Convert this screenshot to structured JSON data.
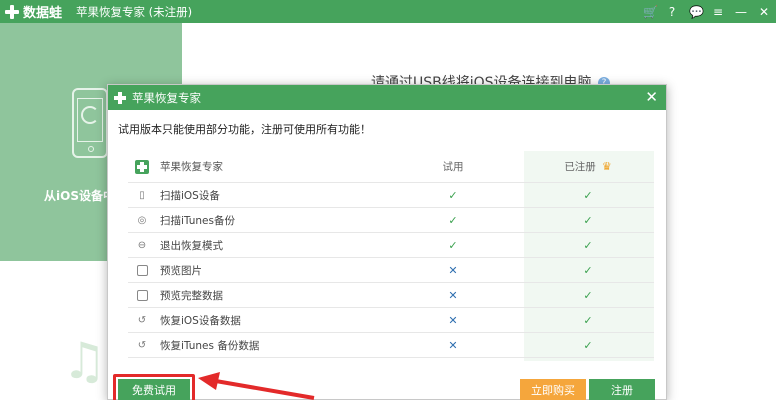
{
  "titlebar": {
    "brand": "数据蛙",
    "title": "苹果恢复专家 (未注册)",
    "icons": [
      "cart-icon",
      "settings-icon",
      "message-icon",
      "menu-icon",
      "minimize-icon",
      "close-icon"
    ]
  },
  "background": {
    "left_label": "从iOS设备中",
    "instruction": "请通过USB线将iOS设备连接到电脑"
  },
  "dialog": {
    "title": "苹果恢复专家",
    "notice": "试用版本只能使用部分功能，注册可使用所有功能！",
    "header": {
      "product": "苹果恢复专家",
      "trial": "试用",
      "registered": "已注册"
    },
    "rows": [
      {
        "icon": "phone-icon",
        "label": "扫描iOS设备",
        "trial": "✓",
        "registered": "✓"
      },
      {
        "icon": "itunes-icon",
        "label": "扫描iTunes备份",
        "trial": "✓",
        "registered": "✓"
      },
      {
        "icon": "exit-icon",
        "label": "退出恢复模式",
        "trial": "✓",
        "registered": "✓"
      },
      {
        "icon": "image-icon",
        "label": "预览图片",
        "trial": "✕",
        "registered": "✓"
      },
      {
        "icon": "data-icon",
        "label": "预览完整数据",
        "trial": "✕",
        "registered": "✓"
      },
      {
        "icon": "restore-icon",
        "label": "恢复iOS设备数据",
        "trial": "✕",
        "registered": "✓"
      },
      {
        "icon": "restore-itunes-icon",
        "label": "恢复iTunes 备份数据",
        "trial": "✕",
        "registered": "✓"
      }
    ],
    "buttons": {
      "free_trial": "免费试用",
      "buy_now": "立即购买",
      "register": "注册"
    }
  },
  "colors": {
    "brand_green": "#46a35c",
    "buy_orange": "#f5a63c",
    "highlight_red": "#e32a2a"
  }
}
